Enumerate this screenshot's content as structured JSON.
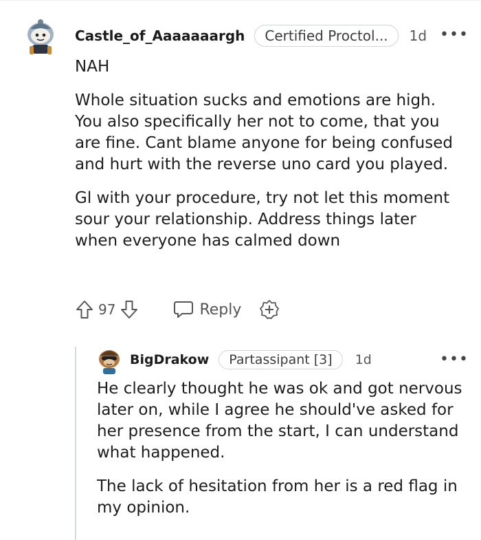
{
  "comment": {
    "username": "Castle_of_Aaaaaaargh",
    "flair": "Certified Proctol...",
    "age": "1d",
    "more": "•••",
    "paragraphs": [
      "NAH",
      "Whole situation sucks and emotions are high. You also specifically her not to come, that you are fine. Cant blame anyone for being confused and hurt with the reverse uno card you played.",
      "Gl with your procedure, try not let this moment sour your relationship. Address things later when everyone has calmed down"
    ],
    "votes": "97",
    "reply_label": "Reply"
  },
  "reply": {
    "username": "BigDrakow",
    "flair": "Partassipant [3]",
    "age": "1d",
    "more": "•••",
    "paragraphs": [
      "He clearly thought he was ok and got nervous later on, while I agree he should've asked for her presence from the start, I can understand what happened.",
      "The lack of hesitation from her is a red flag in my opinion."
    ]
  },
  "icons": {
    "upvote": "upvote-arrow-icon",
    "downvote": "downvote-arrow-icon",
    "reply": "speech-bubble-icon",
    "award": "award-plus-icon",
    "more": "more-dots-icon"
  }
}
